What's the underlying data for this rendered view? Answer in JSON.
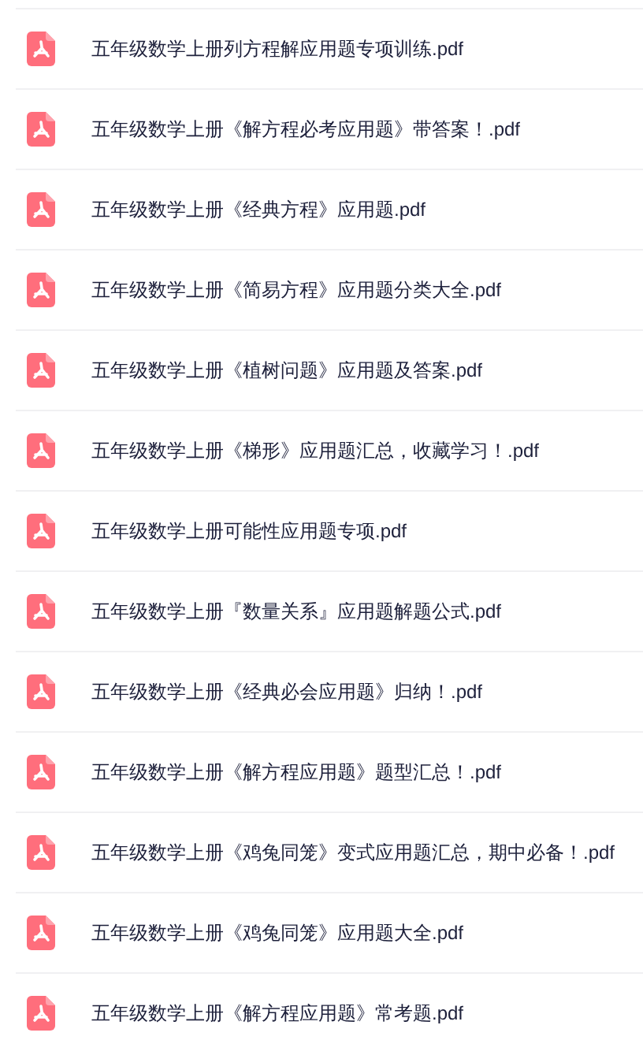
{
  "files": [
    {
      "name": "五年级数学上册列方程解应用题专项训练.pdf"
    },
    {
      "name": "五年级数学上册《解方程必考应用题》带答案！.pdf"
    },
    {
      "name": "五年级数学上册《经典方程》应用题.pdf"
    },
    {
      "name": "五年级数学上册《简易方程》应用题分类大全.pdf"
    },
    {
      "name": "五年级数学上册《植树问题》应用题及答案.pdf"
    },
    {
      "name": "五年级数学上册《梯形》应用题汇总，收藏学习！.pdf"
    },
    {
      "name": "五年级数学上册可能性应用题专项.pdf"
    },
    {
      "name": "五年级数学上册『数量关系』应用题解题公式.pdf"
    },
    {
      "name": "五年级数学上册《经典必会应用题》归纳！.pdf"
    },
    {
      "name": "五年级数学上册《解方程应用题》题型汇总！.pdf"
    },
    {
      "name": "五年级数学上册《鸡兔同笼》变式应用题汇总，期中必备！.pdf"
    },
    {
      "name": "五年级数学上册《鸡兔同笼》应用题大全.pdf"
    },
    {
      "name": "五年级数学上册《解方程应用题》常考题.pdf"
    }
  ]
}
